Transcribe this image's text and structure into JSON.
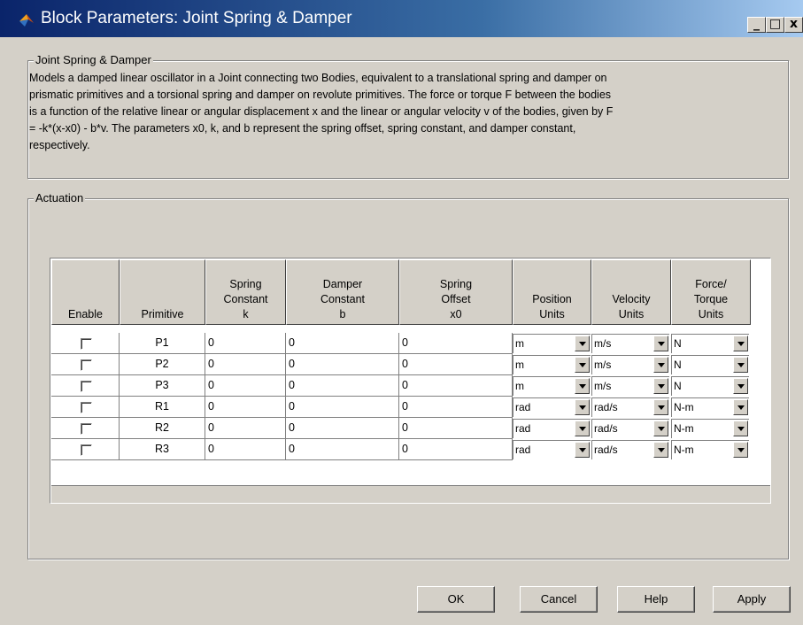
{
  "window": {
    "title": "Block Parameters: Joint Spring & Damper",
    "controls": {
      "minimize": "_",
      "maximize": "□",
      "close": "x"
    }
  },
  "description_group": {
    "legend": "Joint Spring & Damper",
    "lines": [
      "Models a damped linear oscillator in a Joint connecting two Bodies, equivalent to a translational spring and damper on",
      "prismatic primitives and a torsional spring and damper on revolute primitives. The force or torque F between the bodies",
      "is a function of the relative linear or angular displacement x and the linear or angular velocity v of the bodies, given by F",
      "= -k*(x-x0) - b*v. The parameters x0, k, and b represent the spring offset, spring constant, and damper constant,",
      "respectively."
    ]
  },
  "actuation_group": {
    "legend": "Actuation",
    "table": {
      "headers": [
        "Enable",
        "Primitive",
        "Spring\nConstant\nk",
        "Damper\nConstant\nb",
        "Spring\nOffset\nx0",
        "Position\nUnits",
        "Velocity\nUnits",
        "Force/\nTorque\nUnits"
      ],
      "rows": [
        {
          "enabled": false,
          "primitive": "P1",
          "k": "0",
          "b": "0",
          "x0": "0",
          "position_units": "m",
          "velocity_units": "m/s",
          "force_units": "N"
        },
        {
          "enabled": false,
          "primitive": "P2",
          "k": "0",
          "b": "0",
          "x0": "0",
          "position_units": "m",
          "velocity_units": "m/s",
          "force_units": "N"
        },
        {
          "enabled": false,
          "primitive": "P3",
          "k": "0",
          "b": "0",
          "x0": "0",
          "position_units": "m",
          "velocity_units": "m/s",
          "force_units": "N"
        },
        {
          "enabled": false,
          "primitive": "R1",
          "k": "0",
          "b": "0",
          "x0": "0",
          "position_units": "rad",
          "velocity_units": "rad/s",
          "force_units": "N-m"
        },
        {
          "enabled": false,
          "primitive": "R2",
          "k": "0",
          "b": "0",
          "x0": "0",
          "position_units": "rad",
          "velocity_units": "rad/s",
          "force_units": "N-m"
        },
        {
          "enabled": false,
          "primitive": "R3",
          "k": "0",
          "b": "0",
          "x0": "0",
          "position_units": "rad",
          "velocity_units": "rad/s",
          "force_units": "N-m"
        }
      ]
    }
  },
  "buttons": {
    "ok": "OK",
    "cancel": "Cancel",
    "help": "Help",
    "apply": "Apply"
  },
  "colors": {
    "face": "#d4d0c8",
    "title_gradient_start": "#0a246a",
    "title_gradient_end": "#a6caf0"
  }
}
